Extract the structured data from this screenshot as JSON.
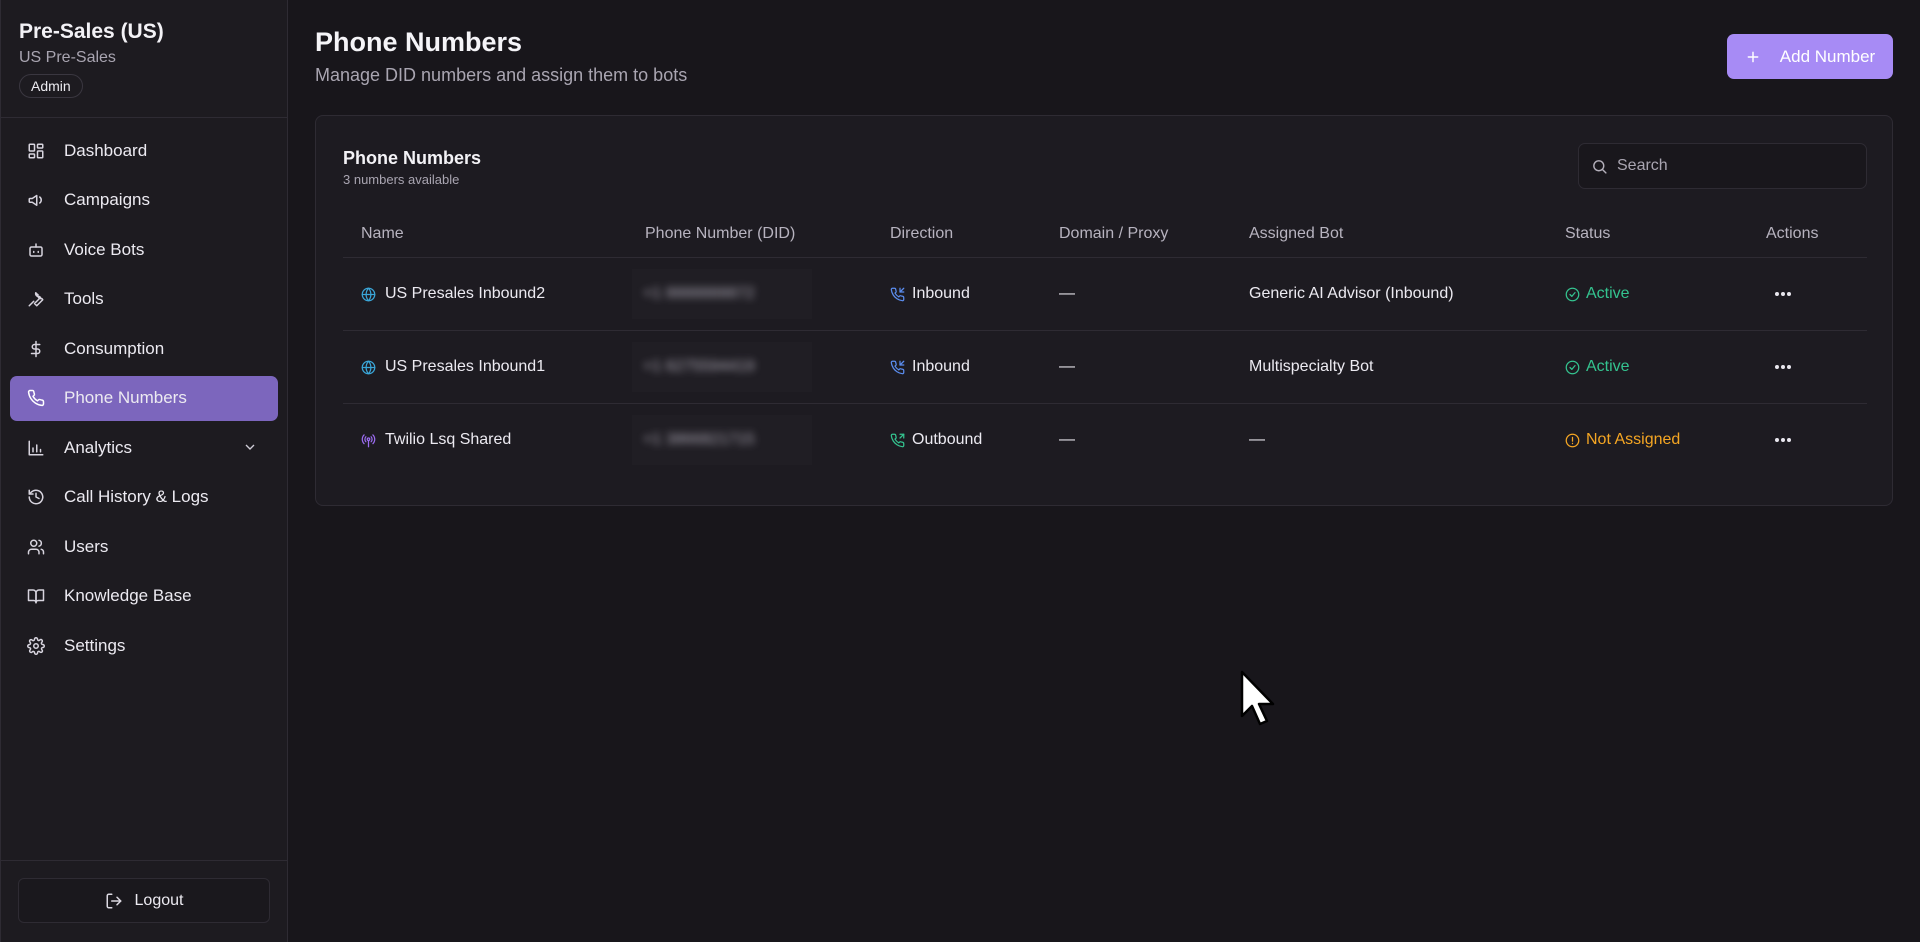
{
  "org": {
    "name": "Pre-Sales (US)",
    "subtitle": "US Pre-Sales",
    "role": "Admin"
  },
  "nav": [
    {
      "label": "Dashboard",
      "icon": "dashboard-icon"
    },
    {
      "label": "Campaigns",
      "icon": "megaphone-icon"
    },
    {
      "label": "Voice Bots",
      "icon": "bot-icon"
    },
    {
      "label": "Tools",
      "icon": "wrench-icon"
    },
    {
      "label": "Consumption",
      "icon": "dollar-icon"
    },
    {
      "label": "Phone Numbers",
      "icon": "phone-icon",
      "active": true
    },
    {
      "label": "Analytics",
      "icon": "bar-chart-icon",
      "expandable": true
    },
    {
      "label": "Call History & Logs",
      "icon": "history-icon"
    },
    {
      "label": "Users",
      "icon": "users-icon"
    },
    {
      "label": "Knowledge Base",
      "icon": "book-icon"
    },
    {
      "label": "Settings",
      "icon": "gear-icon"
    }
  ],
  "logout_label": "Logout",
  "page": {
    "title": "Phone Numbers",
    "subtitle": "Manage DID numbers and assign them to bots",
    "add_button": "Add Number"
  },
  "card": {
    "title": "Phone Numbers",
    "subtitle": "3 numbers available",
    "search_placeholder": "Search"
  },
  "table": {
    "columns": [
      "Name",
      "Phone Number (DID)",
      "Direction",
      "Domain / Proxy",
      "Assigned Bot",
      "Status",
      "Actions"
    ],
    "rows": [
      {
        "name": "US Presales Inbound2",
        "name_icon": "globe-icon",
        "phone": "+1 8888888872",
        "direction": "Inbound",
        "direction_icon": "phone-incoming-icon",
        "domain": "—",
        "bot": "Generic AI Advisor (Inbound)",
        "status": "Active",
        "status_icon": "check-circle-icon"
      },
      {
        "name": "US Presales Inbound1",
        "name_icon": "globe-icon",
        "phone": "+1 6275594419",
        "direction": "Inbound",
        "direction_icon": "phone-incoming-icon",
        "domain": "—",
        "bot": "Multispecialty Bot",
        "status": "Active",
        "status_icon": "check-circle-icon"
      },
      {
        "name": "Twilio Lsq Shared",
        "name_icon": "broadcast-icon",
        "phone": "+1 3866821715",
        "direction": "Outbound",
        "direction_icon": "phone-outgoing-icon",
        "domain": "—",
        "bot": "—",
        "status": "Not Assigned",
        "status_icon": "alert-circle-icon"
      }
    ]
  },
  "colors": {
    "accent": "#a78bf5",
    "active_nav": "#7c66bd",
    "status_active": "#34c38f",
    "status_warning": "#f5a623",
    "inbound_icon": "#5b8def",
    "outbound_icon": "#34c38f",
    "globe_icon": "#3aa6d8",
    "broadcast_icon": "#9b6cf0"
  }
}
